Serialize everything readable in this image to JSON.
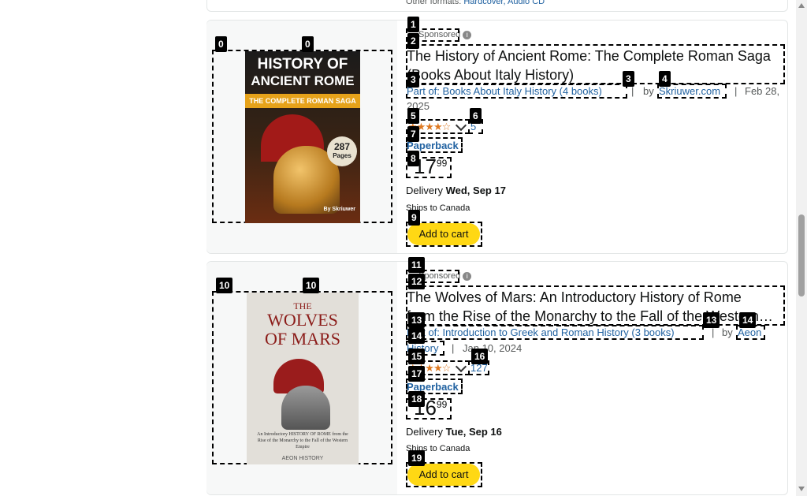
{
  "top_other_formats": {
    "label": "Other formats:",
    "value": "Hardcover, Audio CD"
  },
  "products": [
    {
      "sponsored": "Sponsored",
      "title_line1": "The History of Ancient Rome: The Complete Roman Saga",
      "title_line2": "(Books About Italy History)",
      "series": "Part of: Books About Italy History (4 books)",
      "by": "by",
      "author": "Skriuwer.com",
      "sep": "|",
      "date_line1": "Feb 28,",
      "date_line2": "2025",
      "rating_stars": "★★★★☆",
      "rating_count": "5",
      "format": "Paperback",
      "price_whole": "17",
      "price_fraction": "99",
      "delivery_label": "Delivery",
      "delivery_date": "Wed, Sep 17",
      "ships": "Ships to Canada",
      "cart": "Add to cart",
      "cover": {
        "line1": "HISTORY OF",
        "line2": "ANCIENT ROME",
        "band": "THE COMPLETE ROMAN SAGA",
        "badge_num": "287",
        "badge_label": "Pages",
        "author": "By Skriuwer"
      }
    },
    {
      "sponsored": "Sponsored",
      "title_line1": "The Wolves of Mars: An Introductory History of Rome",
      "title_line2": "from the Rise of the Monarchy to the Fall of the Western…",
      "series": "Part of: Introduction to Greek and Roman History (3 books)",
      "by": "by",
      "author_line1": "Aeon",
      "author_line2": "History",
      "sep": "|",
      "date": "Jan 10, 2024",
      "rating_stars": "★★★★☆",
      "rating_count": "127",
      "format": "Paperback",
      "price_whole": "16",
      "price_fraction": "99",
      "delivery_label": "Delivery",
      "delivery_date": "Tue, Sep 16",
      "ships": "Ships to Canada",
      "cart": "Add to cart",
      "cover": {
        "line1": "THE",
        "line2": "WOLVES",
        "line3": "OF MARS",
        "sub": "An Introductory HISTORY OF ROME from the Rise of the Monarchy to the Fall of the Western Empire",
        "author": "AEON HISTORY"
      }
    }
  ],
  "tags": [
    "0",
    "0",
    "1",
    "2",
    "3",
    "3",
    "4",
    "5",
    "6",
    "7",
    "8",
    "9",
    "10",
    "10",
    "11",
    "12",
    "13",
    "14",
    "13",
    "14",
    "15",
    "16",
    "17",
    "18",
    "19"
  ],
  "colors": {
    "cart": "#ffd814",
    "link": "#2162a1",
    "star": "#de7921"
  }
}
